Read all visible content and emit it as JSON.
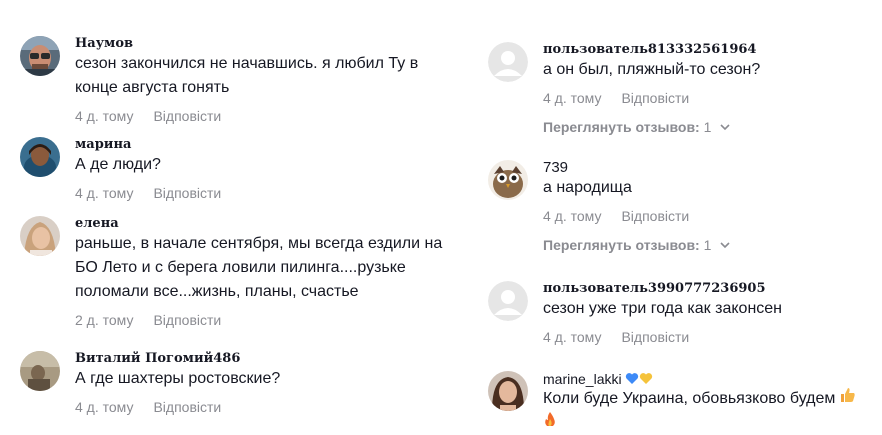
{
  "left": [
    {
      "user": "Наумов",
      "text": "сезон закончился не начавшись. я любил Ту в конце августа гонять",
      "time": "4 д. тому",
      "reply": "Відповісти"
    },
    {
      "user": "марина",
      "text": "А де люди?",
      "time": "4 д. тому",
      "reply": "Відповісти"
    },
    {
      "user": "елена",
      "text": "раньше, в начале сентября, мы всегда ездили на БО Лето и с берега ловили пилинга....рузьке поломали все...жизнь, планы, счастье",
      "time": "2 д. тому",
      "reply": "Відповісти"
    },
    {
      "user": "Виталий Погомий486",
      "text": "А где шахтеры ростовские?",
      "time": "4 д. тому",
      "reply": "Відповісти"
    }
  ],
  "right": [
    {
      "user": "пользователь813332561964",
      "text": "а он был, пляжный-то сезон?",
      "time": "4 д. тому",
      "reply": "Відповісти",
      "view_replies": "Переглянуть отзывов:",
      "reply_count": "1"
    },
    {
      "user": "739",
      "text": "а народища",
      "time": "4 д. тому",
      "reply": "Відповісти",
      "view_replies": "Переглянуть отзывов:",
      "reply_count": "1"
    },
    {
      "user": "пользователь3990777236905",
      "text": "сезон уже три года как законсен",
      "time": "4 д. тому",
      "reply": "Відповісти"
    },
    {
      "user": "marine_lakki",
      "text": "Коли буде Украина, обовьязково будем",
      "time": "",
      "reply": ""
    }
  ],
  "icons": {
    "default_avatar": "default-avatar-icon",
    "chevron": "chevron-down-icon",
    "heart_blue": "blue-heart-emoji",
    "heart_yellow": "yellow-heart-emoji",
    "thumbs_up": "thumbs-up-emoji",
    "fire": "fire-emoji"
  },
  "colors": {
    "meta": "#8a8b91",
    "text": "#161823",
    "heart_blue": "#3d8af7",
    "heart_yellow": "#f5c33b"
  }
}
